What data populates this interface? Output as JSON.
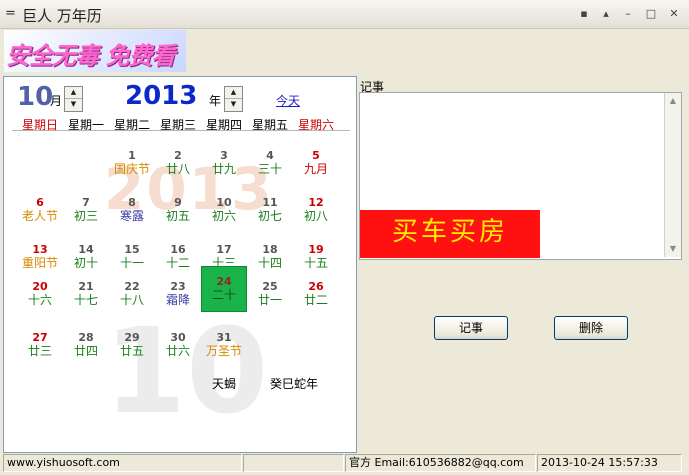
{
  "window": {
    "title": "巨人 万年历",
    "sysmenu_glyph": "=",
    "controls": [
      "▪",
      "▴",
      "–",
      "□",
      "✕"
    ]
  },
  "banner": {
    "text": "安全无毒 免费看"
  },
  "calendar": {
    "month_value": "10",
    "month_unit": "月",
    "year_value": "2013",
    "year_unit": "年",
    "today_link": "今天",
    "watermark_year": "2013",
    "watermark_month": "10",
    "weekdays": [
      "星期日",
      "星期一",
      "星期二",
      "星期三",
      "星期四",
      "星期五",
      "星期六"
    ],
    "colors": {
      "weekend": "#cc0000",
      "weekday": "#000000",
      "festival": "#d68a00",
      "solar_term": "#3a3aa8",
      "lunar": "#1c7f1c",
      "lunar_month": "#cc0000"
    },
    "days": [
      {
        "day": "1",
        "lunar": "国庆节",
        "kind": "festival",
        "col": 2,
        "row": 0
      },
      {
        "day": "2",
        "lunar": "廿八",
        "kind": "lunar",
        "col": 3,
        "row": 0
      },
      {
        "day": "3",
        "lunar": "廿九",
        "kind": "lunar",
        "col": 4,
        "row": 0
      },
      {
        "day": "4",
        "lunar": "三十",
        "kind": "lunar",
        "col": 5,
        "row": 0
      },
      {
        "day": "5",
        "lunar": "九月",
        "kind": "lunar_month",
        "col": 6,
        "row": 0
      },
      {
        "day": "6",
        "lunar": "老人节",
        "kind": "festival",
        "col": 0,
        "row": 1
      },
      {
        "day": "7",
        "lunar": "初三",
        "kind": "lunar",
        "col": 1,
        "row": 1
      },
      {
        "day": "8",
        "lunar": "寒露",
        "kind": "solar_term",
        "col": 2,
        "row": 1
      },
      {
        "day": "9",
        "lunar": "初五",
        "kind": "lunar",
        "col": 3,
        "row": 1
      },
      {
        "day": "10",
        "lunar": "初六",
        "kind": "lunar",
        "col": 4,
        "row": 1
      },
      {
        "day": "11",
        "lunar": "初七",
        "kind": "lunar",
        "col": 5,
        "row": 1
      },
      {
        "day": "12",
        "lunar": "初八",
        "kind": "lunar",
        "col": 6,
        "row": 1
      },
      {
        "day": "13",
        "lunar": "重阳节",
        "kind": "festival",
        "col": 0,
        "row": 2
      },
      {
        "day": "14",
        "lunar": "初十",
        "kind": "lunar",
        "col": 1,
        "row": 2
      },
      {
        "day": "15",
        "lunar": "十一",
        "kind": "lunar",
        "col": 2,
        "row": 2
      },
      {
        "day": "16",
        "lunar": "十二",
        "kind": "lunar",
        "col": 3,
        "row": 2
      },
      {
        "day": "17",
        "lunar": "十三",
        "kind": "lunar",
        "col": 4,
        "row": 2
      },
      {
        "day": "18",
        "lunar": "十四",
        "kind": "lunar",
        "col": 5,
        "row": 2
      },
      {
        "day": "19",
        "lunar": "十五",
        "kind": "lunar",
        "col": 6,
        "row": 2
      },
      {
        "day": "20",
        "lunar": "十六",
        "kind": "lunar",
        "col": 0,
        "row": 3
      },
      {
        "day": "21",
        "lunar": "十七",
        "kind": "lunar",
        "col": 1,
        "row": 3
      },
      {
        "day": "22",
        "lunar": "十八",
        "kind": "lunar",
        "col": 2,
        "row": 3
      },
      {
        "day": "23",
        "lunar": "霜降",
        "kind": "solar_term",
        "col": 3,
        "row": 3
      },
      {
        "day": "24",
        "lunar": "二十",
        "kind": "lunar",
        "col": 4,
        "row": 3,
        "selected": true
      },
      {
        "day": "25",
        "lunar": "廿一",
        "kind": "lunar",
        "col": 5,
        "row": 3
      },
      {
        "day": "26",
        "lunar": "廿二",
        "kind": "lunar",
        "col": 6,
        "row": 3
      },
      {
        "day": "27",
        "lunar": "廿三",
        "kind": "lunar",
        "col": 0,
        "row": 4
      },
      {
        "day": "28",
        "lunar": "廿四",
        "kind": "lunar",
        "col": 1,
        "row": 4
      },
      {
        "day": "29",
        "lunar": "廿五",
        "kind": "lunar",
        "col": 2,
        "row": 4
      },
      {
        "day": "30",
        "lunar": "廿六",
        "kind": "lunar",
        "col": 3,
        "row": 4
      },
      {
        "day": "31",
        "lunar": "万圣节",
        "kind": "festival",
        "col": 4,
        "row": 4
      }
    ],
    "zodiac_sign": "天蝎",
    "ganzhi_year": "癸巳蛇年"
  },
  "memo": {
    "label": "记事",
    "content": "",
    "ad_text": "买车买房",
    "add_button": "记事",
    "delete_button": "删除"
  },
  "statusbar": {
    "website": "www.yishuosoft.com",
    "empty1": "",
    "empty2": "",
    "contact": "官方 Email:610536882@qq.com",
    "datetime": "2013-10-24 15:57:33"
  }
}
